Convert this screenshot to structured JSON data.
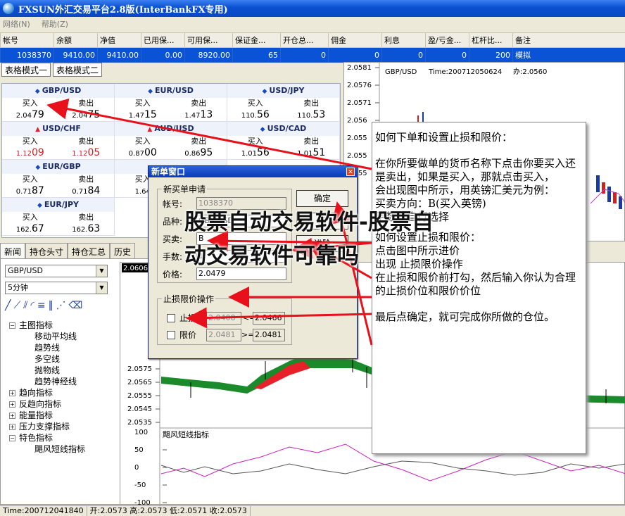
{
  "window": {
    "title": "FXSUN外汇交易平台2.8版(InterBankFX专用)"
  },
  "menu": [
    "网络(N)",
    "帮助(Z)"
  ],
  "account": {
    "headers": [
      "帐号",
      "余额",
      "净值",
      "已用保...",
      "可用保...",
      "保证金...",
      "开仓总...",
      "佣金",
      "利息",
      "盈/亏金...",
      "杠杆比...",
      "备注"
    ],
    "row": [
      "1038370",
      "9410.00",
      "9410.00",
      "0.00",
      "8920.00",
      "65",
      "0",
      "0",
      "0",
      "0",
      "200",
      "模拟"
    ]
  },
  "mode_tabs": [
    "表格模式一",
    "表格模式二"
  ],
  "quotes": [
    {
      "pair": "GBP/USD",
      "up": false,
      "buy_label": "买入",
      "sell_label": "卖出",
      "buy_pre": "2.04",
      "buy_big": "79",
      "sell_pre": "2.04",
      "sell_big": "75",
      "red": false
    },
    {
      "pair": "EUR/USD",
      "up": false,
      "buy_label": "买入",
      "sell_label": "卖出",
      "buy_pre": "1.47",
      "buy_big": "15",
      "sell_pre": "1.47",
      "sell_big": "13",
      "red": false
    },
    {
      "pair": "USD/JPY",
      "up": false,
      "buy_label": "买入",
      "sell_label": "卖出",
      "buy_pre": "110.",
      "buy_big": "56",
      "sell_pre": "110.",
      "sell_big": "53",
      "red": false
    },
    {
      "pair": "USD/CHF",
      "up": true,
      "buy_label": "买入",
      "sell_label": "卖出",
      "buy_pre": "1.12",
      "buy_big": "09",
      "sell_pre": "1.12",
      "sell_big": "05",
      "red": true
    },
    {
      "pair": "AUD/USD",
      "up": true,
      "buy_label": "买入",
      "sell_label": "卖出",
      "buy_pre": "0.87",
      "buy_big": "00",
      "sell_pre": "0.86",
      "sell_big": "95",
      "red": false
    },
    {
      "pair": "USD/CAD",
      "up": false,
      "buy_label": "买入",
      "sell_label": "卖出",
      "buy_pre": "1.01",
      "buy_big": "56",
      "sell_pre": "1.01",
      "sell_big": "51",
      "red": false
    },
    {
      "pair": "EUR/GBP",
      "up": false,
      "buy_label": "买入",
      "sell_label": "卖出",
      "buy_pre": "0.71",
      "buy_big": "87",
      "sell_pre": "0.71",
      "sell_big": "84",
      "red": false
    },
    {
      "pair": "",
      "up": false,
      "buy_label": "买入",
      "sell_label": "",
      "buy_pre": "1.64",
      "buy_big": "",
      "sell_pre": "",
      "sell_big": "",
      "red": false
    },
    {
      "pair": "",
      "up": false,
      "buy_label": "",
      "sell_label": "",
      "buy_pre": "",
      "buy_big": "",
      "sell_pre": "",
      "sell_big": "",
      "red": false
    },
    {
      "pair": "EUR/JPY",
      "up": false,
      "buy_label": "买入",
      "sell_label": "卖出",
      "buy_pre": "162.",
      "buy_big": "67",
      "sell_pre": "162.",
      "sell_big": "63",
      "red": false
    }
  ],
  "panel_tabs": [
    "新闻",
    "持仓头寸",
    "持仓汇总",
    "历史"
  ],
  "left_panel": {
    "symbol": "GBP/USD",
    "period": "5分钟",
    "tree": [
      {
        "label": "主图指标",
        "expanded": true,
        "children": [
          "移动平均线",
          "趋势线",
          "多空线",
          "抛物线",
          "趋势神经线"
        ]
      },
      {
        "label": "趋向指标",
        "expanded": false,
        "children": []
      },
      {
        "label": "反趋向指标",
        "expanded": false,
        "children": []
      },
      {
        "label": "能量指标",
        "expanded": false,
        "children": []
      },
      {
        "label": "压力支撑指标",
        "expanded": false,
        "children": []
      },
      {
        "label": "特色指标",
        "expanded": true,
        "children": [
          "飓风短线指标"
        ]
      }
    ]
  },
  "chart_top": {
    "symbol": "GBP/USD",
    "time": "Time:200712050624",
    "value": "办:2.0560",
    "yticks": [
      "2.0581",
      "2.0576",
      "2.0571",
      "2.056",
      "2.055",
      "2.055",
      "2.055"
    ]
  },
  "chart_main": {
    "price_box": "2.0606",
    "yticks": [
      "2.0575",
      "2.0565",
      "2.0555",
      "2.0545",
      "2.0535"
    ],
    "indicator_title": "飓风短线指标",
    "indicator_yticks": [
      "100",
      "50",
      "0",
      "-50",
      "-100"
    ]
  },
  "dialog": {
    "title": "新单窗口",
    "group1": "新买单申请",
    "fields": [
      {
        "label": "帐号:",
        "value": "1038370"
      },
      {
        "label": "品种:",
        "value": "GBP/USD"
      },
      {
        "label": "买卖:",
        "value": "B"
      },
      {
        "label": "手数:",
        "value": "1"
      },
      {
        "label": "价格:",
        "value": "2.0479"
      }
    ],
    "confirm": "确定",
    "button2": "取",
    "button3": "进阶",
    "group2": "止损限价操作",
    "stop_label": "止损",
    "stop_value1": "2.0408",
    "stop_op": "<=",
    "stop_value2": "2.0466",
    "limit_label": "限价",
    "limit_value1": "2.0481",
    "limit_op": ">=",
    "limit_value2": "2.0481"
  },
  "note": {
    "p1": "如何下单和设置止损和限价：",
    "p2": "在你所要做单的货币名称下点击你要买入还是卖出，如果是买入，那就点击买入，",
    "p3": "会出现图中所示，用英镑汇美元为例：",
    "p4": "买卖方向：B(买入英镑)",
    "p5": "手数可自行选择",
    "p6": "如何设置止损和限价：",
    "p7": "点击图中所示进价",
    "p8": "出现 止损限价操作",
    "p9": "在止损和限价前打勾，然后输入你认为合理的止损价位和限价价位",
    "p10": "最后点确定，就可完成你所做的仓位。"
  },
  "headline": "股票自动交易软件-股票自动交易软件可靠吗",
  "status": {
    "time": "Time:200712041840",
    "values": "开:2.0573 高:2.0573 低:2.0571 收:2.0573"
  }
}
